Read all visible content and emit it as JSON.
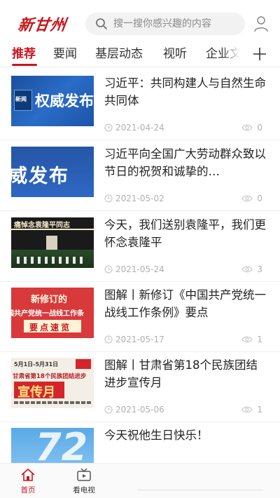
{
  "header": {
    "logo_text": "新甘州",
    "search_placeholder": "搜一搜你感兴趣的内容"
  },
  "tabs": [
    {
      "label": "推荐",
      "active": true
    },
    {
      "label": "要闻",
      "active": false
    },
    {
      "label": "基层动态",
      "active": false
    },
    {
      "label": "视听",
      "active": false
    },
    {
      "label": "企业文",
      "active": false
    }
  ],
  "articles": [
    {
      "title": "习近平：共同构建人与自然生命共同体",
      "date": "2021-04-24",
      "views": "0",
      "thumb_text": "权威发布",
      "thumb_side": "新闻"
    },
    {
      "title": "习近平向全国广大劳动群众致以节日的祝贺和诚挚的…",
      "date": "2021-05-02",
      "views": "0",
      "thumb_text": "威发布"
    },
    {
      "title": "今天，我们送别袁隆平，我们更怀念袁隆平",
      "date": "2021-05-24",
      "views": "3",
      "thumb_text": "痛悼念袁隆平同志"
    },
    {
      "title": "图解丨新修订《中国共产党统一战线工作条例》要点",
      "date": "2021-05-17",
      "views": "1",
      "thumb_line1": "新修订的",
      "thumb_line2": "国共产党统一战线工作条",
      "thumb_line3": "要点速览"
    },
    {
      "title": "图解丨甘肃省第18个民族团结进步宣传月",
      "date": "2021-05-06",
      "views": "1",
      "thumb_line1": "5月1日-5月31日",
      "thumb_line2": "甘肃省第18个民族团结进步",
      "thumb_line3": "宣传月"
    },
    {
      "title": "今天祝他生日快乐！",
      "thumb_text": "72"
    }
  ],
  "bottom_nav": [
    {
      "label": "首页",
      "icon": "home-icon",
      "active": true
    },
    {
      "label": "看电视",
      "icon": "tv-icon",
      "active": false
    }
  ],
  "colors": {
    "brand_red": "#c8161d",
    "meta_gray": "#b0b0b0"
  }
}
